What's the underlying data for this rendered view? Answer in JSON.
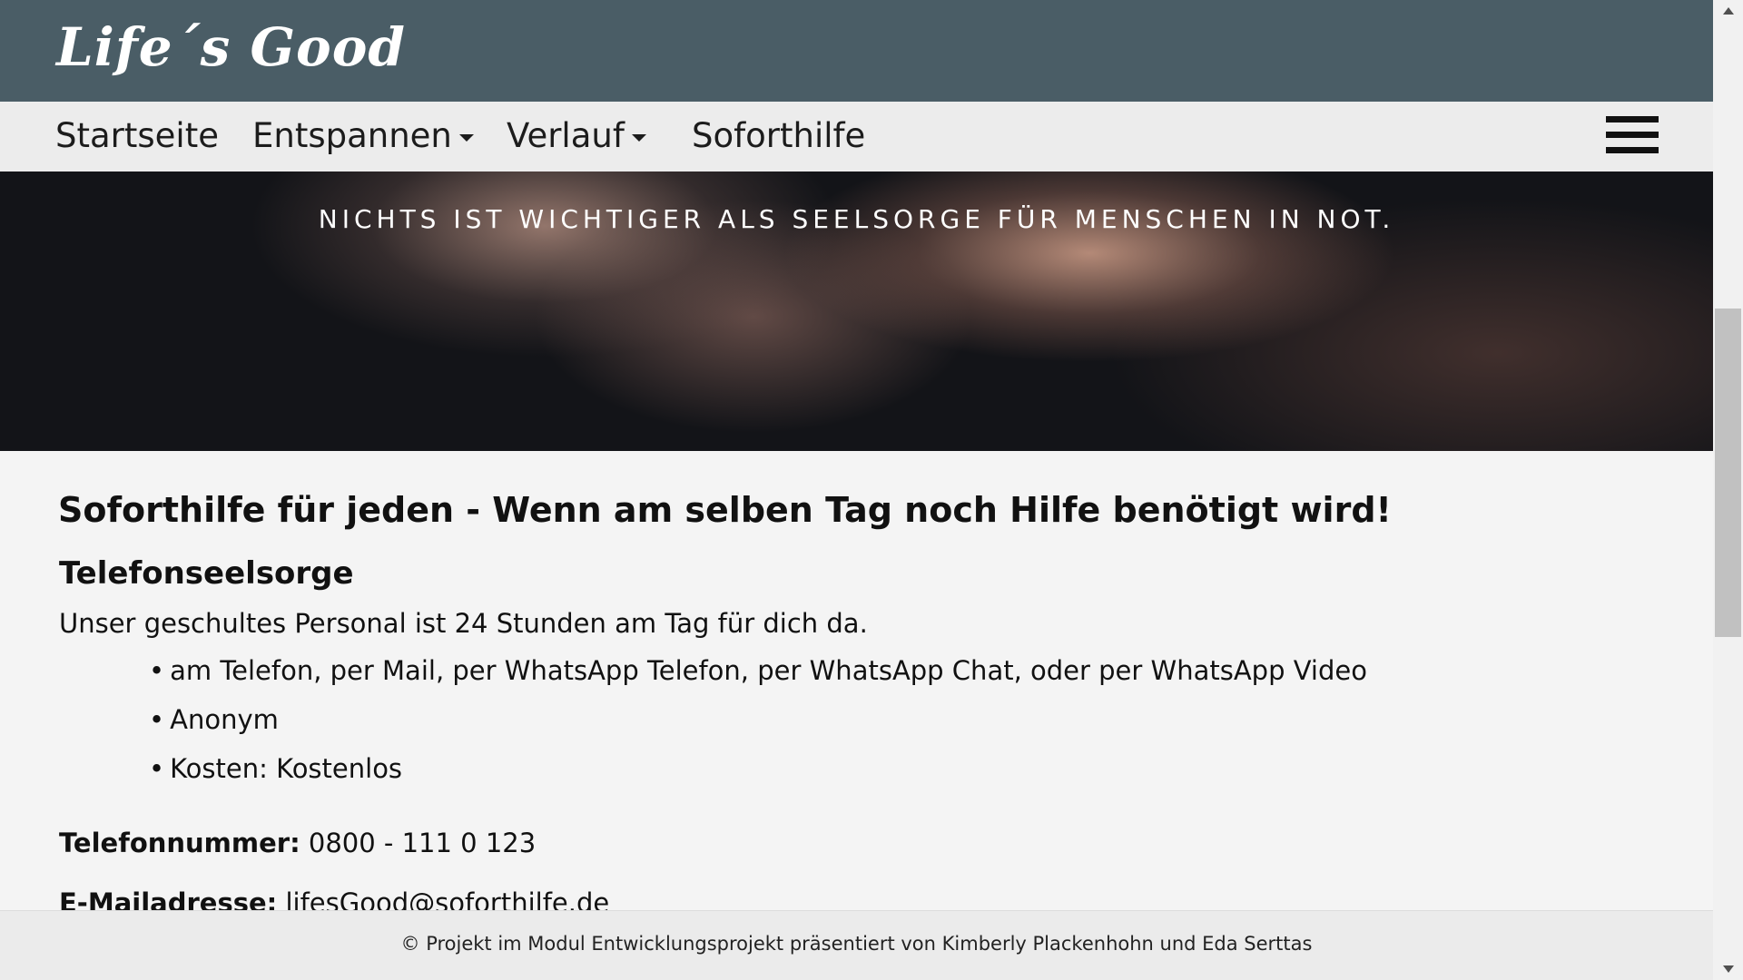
{
  "brand": {
    "logo_text": "Life´s Good"
  },
  "nav": {
    "items": [
      {
        "label": "Startseite",
        "has_dropdown": false
      },
      {
        "label": "Entspannen",
        "has_dropdown": true
      },
      {
        "label": "Verlauf",
        "has_dropdown": true
      },
      {
        "label": "Soforthilfe",
        "has_dropdown": false
      }
    ],
    "menu_icon": "hamburger-menu-icon"
  },
  "hero": {
    "tagline": "NICHTS IST WICHTIGER ALS SEELSORGE FÜR MENSCHEN IN NOT."
  },
  "main": {
    "title": "Soforthilfe für jeden - Wenn am selben Tag noch Hilfe benötigt wird!",
    "section_title": "Telefonseelsorge",
    "intro": "Unser geschultes Personal ist 24 Stunden am Tag für dich da.",
    "bullets": [
      "am Telefon, per Mail, per WhatsApp Telefon, per WhatsApp Chat, oder per WhatsApp Video",
      "Anonym",
      "Kosten: Kostenlos"
    ],
    "phone_label": "Telefonnummer:",
    "phone_value": "0800 - 111 0 123",
    "email_label": "E-Mailadresse:",
    "email_value": "lifesGood@soforthilfe.de"
  },
  "footer": {
    "text": "© Projekt im Modul Entwicklungsprojekt präsentiert von Kimberly Plackenhohn und Eda Serttas"
  },
  "colors": {
    "brand_bar": "#4a5d66",
    "nav_bg": "#ececec",
    "page_bg": "#f4f4f4",
    "footer_bg": "#ebebeb"
  }
}
